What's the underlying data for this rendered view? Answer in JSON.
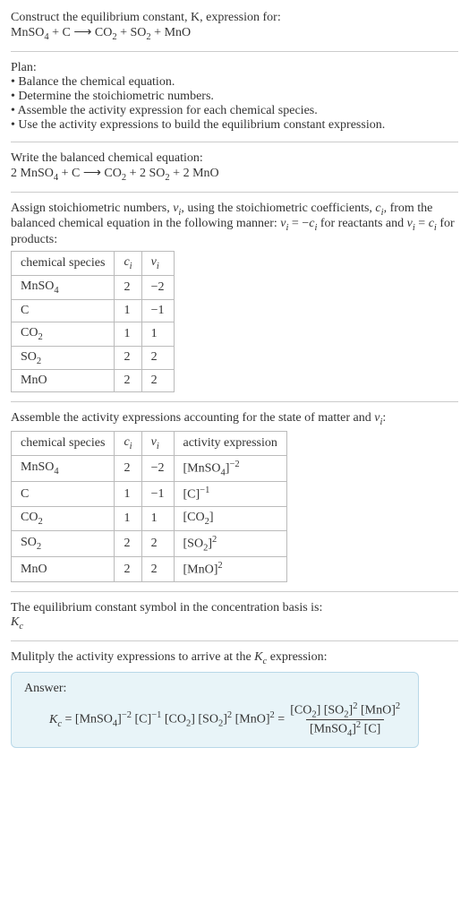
{
  "intro": {
    "line1": "Construct the equilibrium constant, K, expression for:",
    "eq_html": "MnSO<sub>4</sub> + C ⟶ CO<sub>2</sub> + SO<sub>2</sub> + MnO"
  },
  "plan": {
    "title": "Plan:",
    "items": [
      "Balance the chemical equation.",
      "Determine the stoichiometric numbers.",
      "Assemble the activity expression for each chemical species.",
      "Use the activity expressions to build the equilibrium constant expression."
    ]
  },
  "balanced": {
    "intro": "Write the balanced chemical equation:",
    "eq_html": "2 MnSO<sub>4</sub> + C ⟶ CO<sub>2</sub> + 2 SO<sub>2</sub> + 2 MnO"
  },
  "stoich": {
    "intro_html": "Assign stoichiometric numbers, <span class=\"italic\">ν<sub>i</sub></span>, using the stoichiometric coefficients, <span class=\"italic\">c<sub>i</sub></span>, from the balanced chemical equation in the following manner: <span class=\"italic\">ν<sub>i</sub></span> = −<span class=\"italic\">c<sub>i</sub></span> for reactants and <span class=\"italic\">ν<sub>i</sub></span> = <span class=\"italic\">c<sub>i</sub></span> for products:",
    "headers": {
      "species": "chemical species",
      "ci_html": "<span class=\"italic\">c<sub>i</sub></span>",
      "vi_html": "<span class=\"italic\">ν<sub>i</sub></span>"
    },
    "rows": [
      {
        "species_html": "MnSO<sub>4</sub>",
        "ci": "2",
        "vi": "−2"
      },
      {
        "species_html": "C",
        "ci": "1",
        "vi": "−1"
      },
      {
        "species_html": "CO<sub>2</sub>",
        "ci": "1",
        "vi": "1"
      },
      {
        "species_html": "SO<sub>2</sub>",
        "ci": "2",
        "vi": "2"
      },
      {
        "species_html": "MnO",
        "ci": "2",
        "vi": "2"
      }
    ]
  },
  "activity": {
    "intro_html": "Assemble the activity expressions accounting for the state of matter and <span class=\"italic\">ν<sub>i</sub></span>:",
    "headers": {
      "species": "chemical species",
      "ci_html": "<span class=\"italic\">c<sub>i</sub></span>",
      "vi_html": "<span class=\"italic\">ν<sub>i</sub></span>",
      "act": "activity expression"
    },
    "rows": [
      {
        "species_html": "MnSO<sub>4</sub>",
        "ci": "2",
        "vi": "−2",
        "act_html": "[MnSO<sub>4</sub>]<sup>−2</sup>"
      },
      {
        "species_html": "C",
        "ci": "1",
        "vi": "−1",
        "act_html": "[C]<sup>−1</sup>"
      },
      {
        "species_html": "CO<sub>2</sub>",
        "ci": "1",
        "vi": "1",
        "act_html": "[CO<sub>2</sub>]"
      },
      {
        "species_html": "SO<sub>2</sub>",
        "ci": "2",
        "vi": "2",
        "act_html": "[SO<sub>2</sub>]<sup>2</sup>"
      },
      {
        "species_html": "MnO",
        "ci": "2",
        "vi": "2",
        "act_html": "[MnO]<sup>2</sup>"
      }
    ]
  },
  "eqconst": {
    "line1": "The equilibrium constant symbol in the concentration basis is:",
    "symbol_html": "<span class=\"italic\">K<sub>c</sub></span>"
  },
  "multiply": {
    "intro_html": "Mulitply the activity expressions to arrive at the <span class=\"italic\">K<sub>c</sub></span> expression:"
  },
  "answer": {
    "label": "Answer:",
    "lhs_html": "<span class=\"italic\">K<sub>c</sub></span> = [MnSO<sub>4</sub>]<sup>−2</sup> [C]<sup>−1</sup> [CO<sub>2</sub>] [SO<sub>2</sub>]<sup>2</sup> [MnO]<sup>2</sup> = ",
    "num_html": "[CO<sub>2</sub>] [SO<sub>2</sub>]<sup>2</sup> [MnO]<sup>2</sup>",
    "den_html": "[MnSO<sub>4</sub>]<sup>2</sup> [C]"
  }
}
